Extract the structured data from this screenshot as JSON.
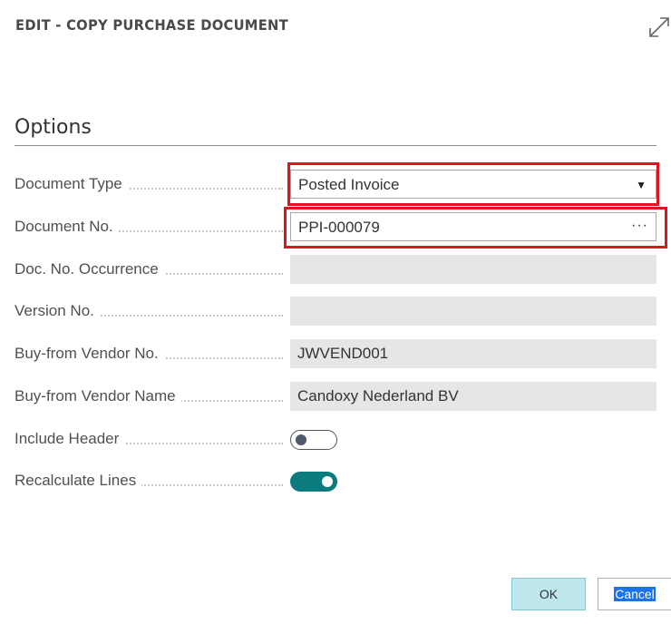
{
  "dialog": {
    "title": "EDIT - COPY PURCHASE DOCUMENT",
    "expand_icon": "expand-arrows-icon"
  },
  "options": {
    "section_title": "Options",
    "fields": {
      "document_type": {
        "label": "Document Type",
        "value": "Posted Invoice"
      },
      "document_no": {
        "label": "Document No.",
        "value": "PPI-000079",
        "lookup": "···"
      },
      "doc_no_occurrence": {
        "label": "Doc. No. Occurrence",
        "value": ""
      },
      "version_no": {
        "label": "Version No.",
        "value": ""
      },
      "buy_from_vendor_no": {
        "label": "Buy-from Vendor No.",
        "value": "JWVEND001"
      },
      "buy_from_vendor_name": {
        "label": "Buy-from Vendor Name",
        "value": "Candoxy Nederland BV"
      },
      "include_header": {
        "label": "Include Header",
        "checked": false
      },
      "recalculate_lines": {
        "label": "Recalculate Lines",
        "checked": true
      }
    }
  },
  "buttons": {
    "ok": "OK",
    "cancel": "Cancel"
  },
  "colors": {
    "highlight": "#e0141e",
    "toggle_on": "#0b7b80",
    "ok_button": "#bfe8ee"
  }
}
